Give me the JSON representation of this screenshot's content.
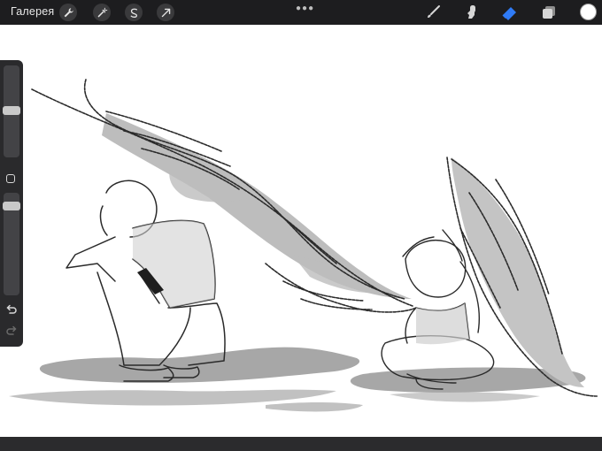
{
  "header": {
    "gallery_label": "Галерея",
    "left_tools": [
      {
        "icon": "wrench-icon"
      },
      {
        "icon": "magic-wand-icon"
      },
      {
        "icon": "selection-icon"
      },
      {
        "icon": "transform-arrow-icon"
      }
    ],
    "right_tools": [
      {
        "icon": "brush-icon"
      },
      {
        "icon": "smudge-icon"
      },
      {
        "icon": "eraser-icon",
        "active": true
      },
      {
        "icon": "layers-icon"
      }
    ],
    "current_color": "#ffffff",
    "accent_color": "#2f7bf6"
  },
  "sidebar": {
    "brush_size_level": 0.35,
    "opacity_level": 0.35,
    "modify_button": "square-modify-icon",
    "undo": "undo-icon",
    "redo": "redo-icon"
  }
}
